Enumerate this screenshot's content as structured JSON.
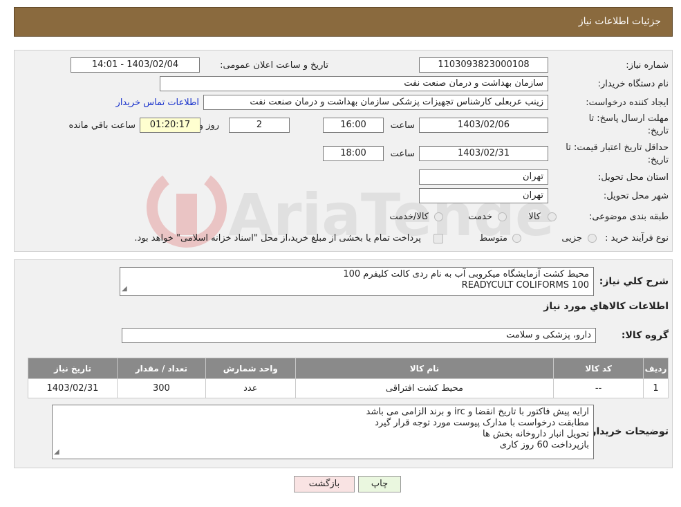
{
  "header": {
    "title": "جزئیات اطلاعات نیاز"
  },
  "form": {
    "need_number_label": "شماره نیاز:",
    "need_number": "1103093823000108",
    "announce_label": "تاریخ و ساعت اعلان عمومی:",
    "announce_value": "1403/02/04 - 14:01",
    "buyer_org_label": "نام دستگاه خریدار:",
    "buyer_org": "سازمان بهداشت و درمان صنعت نفت",
    "requester_label": "ایجاد کننده درخواست:",
    "requester": "زینب عربعلی کارشناس تجهیزات پزشکی سازمان بهداشت و درمان صنعت نفت",
    "contact_link": "اطلاعات تماس خریدار",
    "deadline_label_1": "مهلت ارسال پاسخ: تا",
    "deadline_label_2": "تاریخ:",
    "deadline_date": "1403/02/06",
    "time_label": "ساعت",
    "deadline_time": "16:00",
    "days_value": "2",
    "days_label": "روز و",
    "remaining_time": "01:20:17",
    "remaining_label": "ساعت باقي مانده",
    "validity_label_1": "حداقل تاریخ اعتبار قیمت: تا",
    "validity_label_2": "تاریخ:",
    "validity_date": "1403/02/31",
    "validity_time_label": "ساعت",
    "validity_time": "18:00",
    "province_label": "استان محل تحویل:",
    "province": "تهران",
    "city_label": "شهر محل تحویل:",
    "city": "تهران",
    "category_label": "طبقه بندی موضوعی:",
    "category_options": [
      "کالا",
      "خدمت",
      "کالا/خدمت"
    ],
    "process_label": "نوع فرآیند خرید :",
    "process_options": [
      "جزیی",
      "متوسط"
    ],
    "process_note": "پرداخت تمام یا بخشی از مبلغ خرید،از محل \"اسناد خزانه اسلامی\" خواهد بود."
  },
  "details": {
    "summary_label": "شرح کلي نياز:",
    "summary_line1": "محیط کشت آزمایشگاه میکروبی آب به نام ردی کالت کلیفرم 100",
    "summary_line2": "READYCULT COLIFORMS 100",
    "items_title": "اطلاعات کالاهاي مورد نياز",
    "group_label": "گروه کالا:",
    "group_value": "دارو، پزشکی و سلامت",
    "table": {
      "headers": [
        "ردیف",
        "کد کالا",
        "نام کالا",
        "واحد شمارش",
        "تعداد / مقدار",
        "تاریخ نیاز"
      ],
      "rows": [
        [
          "1",
          "--",
          "محیط کشت افتراقی",
          "عدد",
          "300",
          "1403/02/31"
        ]
      ]
    },
    "buyer_notes_label": "توضیحات خریدار:",
    "buyer_notes": [
      "ارایه  پیش فاکتور با تاریخ انقضا و irc  و برند الزامی می باشد",
      "مطابقت درخواست با مدارک پیوست مورد توجه قرار گیرد",
      "تحویل انبار داروخانه بخش ها",
      "بازپرداخت 60 روز کاری"
    ]
  },
  "buttons": {
    "print": "چاپ",
    "back": "بازگشت"
  },
  "colors": {
    "header_bg": "#8a6a3e",
    "link": "#1a33cc",
    "table_header": "#8a8a8a",
    "print_btn": "#eaf7df",
    "back_btn": "#f9e3e3"
  }
}
